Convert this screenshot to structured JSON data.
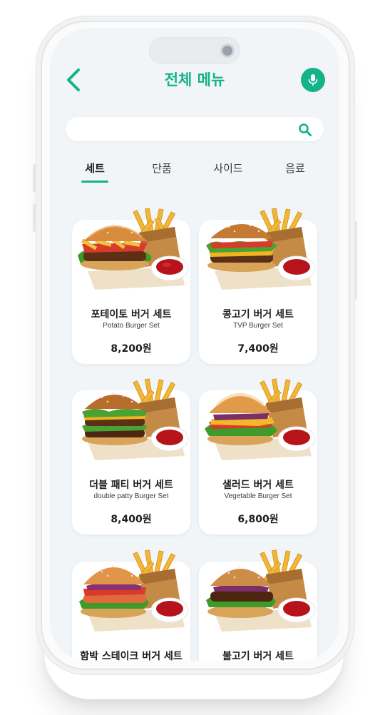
{
  "header": {
    "title": "전체 메뉴"
  },
  "search": {
    "value": "",
    "placeholder": ""
  },
  "tabs": [
    {
      "label": "세트"
    },
    {
      "label": "단품"
    },
    {
      "label": "사이드"
    },
    {
      "label": "음료"
    }
  ],
  "active_tab": "세트",
  "menu": [
    {
      "name": "포테이토 버거 세트",
      "sub": "Potato Burger Set",
      "price": "8,200원"
    },
    {
      "name": "콩고기 버거 세트",
      "sub": "TVP Burger Set",
      "price": "7,400원"
    },
    {
      "name": "더블 패티 버거 세트",
      "sub": "double patty Burger Set",
      "price": "8,400원"
    },
    {
      "name": "샐러드 버거 세트",
      "sub": "Vegetable Burger Set",
      "price": "6,800원"
    },
    {
      "name": "함박 스테이크 버거 세트",
      "sub": "",
      "price": ""
    },
    {
      "name": "불고기 버거 세트",
      "sub": "",
      "price": ""
    }
  ],
  "colors": {
    "accent": "#14b38a",
    "screen_bg": "#f2f5f8",
    "card_bg": "#ffffff"
  },
  "icons": {
    "back": "chevron-left-icon",
    "mic": "mic-icon",
    "search": "search-icon"
  }
}
